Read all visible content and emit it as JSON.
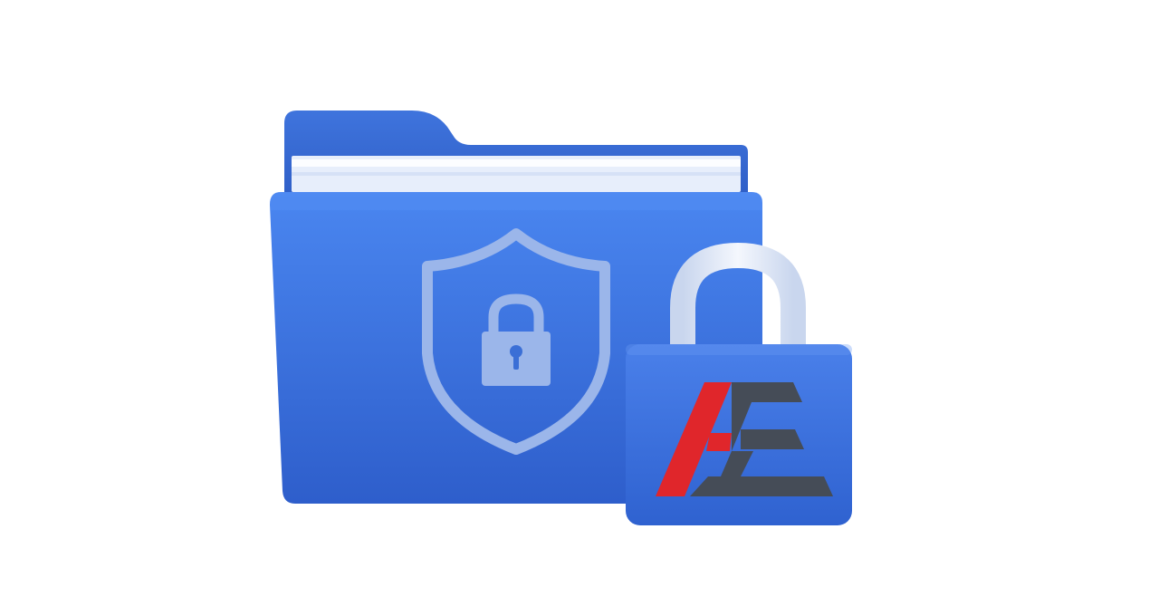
{
  "illustration": {
    "subject": "secure-folder-with-padlock",
    "icons": [
      "folder-icon",
      "shield-icon",
      "lock-icon",
      "padlock-icon",
      "brand-logo"
    ],
    "colors": {
      "background": "#ffffff",
      "folder_back": "#3a6fd8",
      "folder_front_top": "#4a86f0",
      "folder_front_bottom": "#2e5ecb",
      "paper": "#eef3fc",
      "shield_outline": "#9bb6ea",
      "lock_fill": "#9bb6ea",
      "padlock_shackle": "#e4ebf7",
      "padlock_body": "#3a6fd8",
      "logo_red": "#e0262b",
      "logo_gray": "#454c57"
    },
    "logo_text": "AE"
  }
}
